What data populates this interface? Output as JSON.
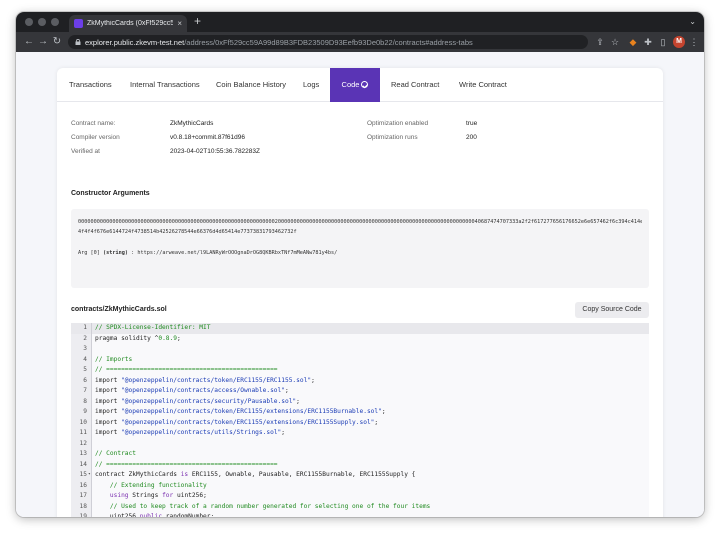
{
  "browser": {
    "tab_title": "ZkMythicCards (0xFf529cc59A...",
    "tab_close": "×",
    "new_tab": "+",
    "url_host": "explorer.public.zkevm-test.net",
    "url_path": "/address/0xFf529cc59A99d89B3FDB23509D93Eefb93De0b22/contracts#address-tabs",
    "profile_initial": "M"
  },
  "tabs": [
    {
      "label": "Transactions"
    },
    {
      "label": "Internal Transactions"
    },
    {
      "label": "Coin Balance History"
    },
    {
      "label": "Logs"
    },
    {
      "label": "Code",
      "active": true
    },
    {
      "label": "Read Contract"
    },
    {
      "label": "Write Contract"
    }
  ],
  "contract_info": {
    "name_label": "Contract name:",
    "name_value": "ZkMythicCards",
    "compiler_label": "Compiler version",
    "compiler_value": "v0.8.18+commit.87f61d96",
    "verified_label": "Verified at",
    "verified_value": "2023-04-02T10:55:36.782283Z",
    "optimization_label": "Optimization enabled",
    "optimization_value": "true",
    "runs_label": "Optimization runs",
    "runs_value": "200"
  },
  "constructor": {
    "title": "Constructor Arguments",
    "hex": "000000000000000000000000000000000000000000000000000000000000000200000000000000000000000000000000000000000000000000000000000000040687474707333a2f2f617277656176652e6e657462f6c394c414e52795772",
    "hex2": "4f4f4f676e6144724f4738514b42526278544e66376d4d65414e7737383179346273​2f",
    "arg_prefix": "Arg [0] ",
    "arg_type": "(string)",
    "arg_value": " : https://arweave.net/l9LANRyWrOOOgnaDrOG8QKBRbxTNf7mMeANw781y4bs/"
  },
  "source": {
    "filename": "contracts/ZkMythicCards.sol",
    "copy_label": "Copy Source Code",
    "lines": [
      {
        "n": "1",
        "html": "<span class=\"c-comment\">// SPDX-License-Identifier: MIT</span>"
      },
      {
        "n": "2",
        "html": "pragma solidity ^<span class=\"c-num\">0.8.9</span>;"
      },
      {
        "n": "3",
        "html": ""
      },
      {
        "n": "4",
        "html": "<span class=\"c-comment\">// Imports</span>"
      },
      {
        "n": "5",
        "html": "<span class=\"c-comment\">// ==============================================</span>"
      },
      {
        "n": "6",
        "html": "import <span class=\"c-str\">\"@openzeppelin/contracts/token/ERC1155/ERC1155.sol\"</span>;"
      },
      {
        "n": "7",
        "html": "import <span class=\"c-str\">\"@openzeppelin/contracts/access/Ownable.sol\"</span>;"
      },
      {
        "n": "8",
        "html": "import <span class=\"c-str\">\"@openzeppelin/contracts/security/Pausable.sol\"</span>;"
      },
      {
        "n": "9",
        "html": "import <span class=\"c-str\">\"@openzeppelin/contracts/token/ERC1155/extensions/ERC1155Burnable.sol\"</span>;"
      },
      {
        "n": "10",
        "html": "import <span class=\"c-str\">\"@openzeppelin/contracts/token/ERC1155/extensions/ERC1155Supply.sol\"</span>;"
      },
      {
        "n": "11",
        "html": "import <span class=\"c-str\">\"@openzeppelin/contracts/utils/Strings.sol\"</span>;"
      },
      {
        "n": "12",
        "html": ""
      },
      {
        "n": "13",
        "html": "<span class=\"c-comment\">// Contract</span>"
      },
      {
        "n": "14",
        "html": "<span class=\"c-comment\">// ==============================================</span>"
      },
      {
        "n": "15",
        "html": "contract ZkMythicCards <span class=\"c-kw\">is</span> ERC1155, Ownable, Pausable, ERC1155Burnable, ERC1155Supply {",
        "fold": true
      },
      {
        "n": "16",
        "html": "    <span class=\"c-comment\">// Extending functionality</span>"
      },
      {
        "n": "17",
        "html": "    <span class=\"c-kw\">using</span> Strings <span class=\"c-kw\">for</span> uint256;"
      },
      {
        "n": "18",
        "html": "    <span class=\"c-comment\">// Used to keep track of a random number generated for selecting one of the four items</span>"
      },
      {
        "n": "19",
        "html": "    uint256 <span class=\"c-kw\">public</span> randomNumber;"
      }
    ]
  },
  "colors": {
    "accent": "#5a34b5",
    "comment": "#1f8a1f",
    "keyword": "#7a2fb0",
    "string": "#1a3bb5"
  },
  "icons": [
    "back-icon",
    "forward-icon",
    "reload-icon",
    "lock-icon",
    "share-icon",
    "star-icon",
    "fox-extension-icon",
    "puzzle-extension-icon",
    "sidepanel-icon",
    "menu-icon",
    "check-circle-icon"
  ]
}
